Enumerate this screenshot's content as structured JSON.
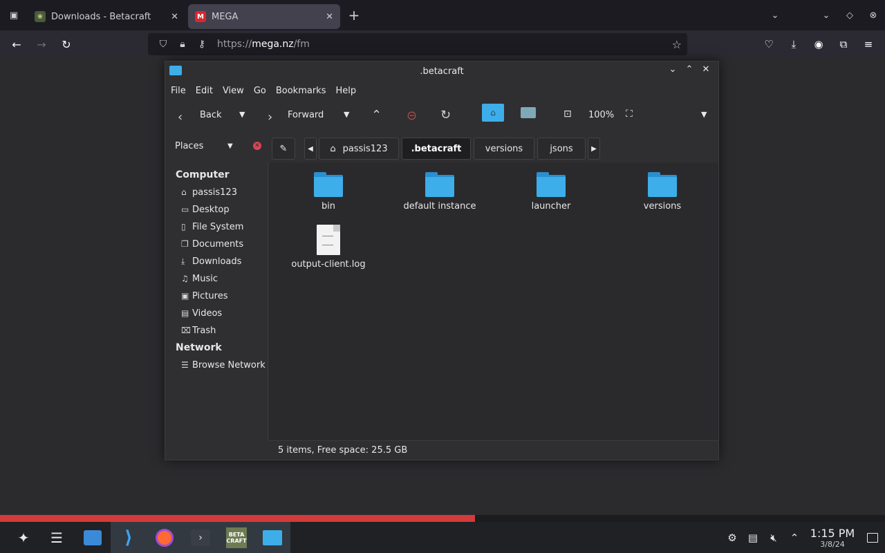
{
  "browser": {
    "tabs": [
      {
        "title": "Downloads - Betacraft",
        "close": "✕"
      },
      {
        "title": "MEGA",
        "icon_letter": "M",
        "close": "✕"
      }
    ],
    "new_tab": "+",
    "url_prefix": "https://",
    "url_host": "mega.nz",
    "url_path": "/fm"
  },
  "file_manager": {
    "title": ".betacraft",
    "menu": [
      "File",
      "Edit",
      "View",
      "Go",
      "Bookmarks",
      "Help"
    ],
    "toolbar": {
      "back_label": "Back",
      "forward_label": "Forward",
      "zoom_label": "100%"
    },
    "places_label": "Places",
    "breadcrumbs": [
      "passis123",
      ".betacraft",
      "versions",
      "jsons"
    ],
    "sidebar": {
      "computer_heading": "Computer",
      "computer_items": [
        {
          "label": "passis123",
          "icon": "home-icon"
        },
        {
          "label": "Desktop",
          "icon": "desktop-icon"
        },
        {
          "label": "File System",
          "icon": "drive-icon"
        },
        {
          "label": "Documents",
          "icon": "documents-icon"
        },
        {
          "label": "Downloads",
          "icon": "downloads-icon"
        },
        {
          "label": "Music",
          "icon": "music-icon"
        },
        {
          "label": "Pictures",
          "icon": "pictures-icon"
        },
        {
          "label": "Videos",
          "icon": "videos-icon"
        },
        {
          "label": "Trash",
          "icon": "trash-icon"
        }
      ],
      "network_heading": "Network",
      "network_items": [
        {
          "label": "Browse Network",
          "icon": "network-icon"
        }
      ]
    },
    "files": [
      {
        "name": "bin",
        "type": "folder"
      },
      {
        "name": "default instance",
        "type": "folder"
      },
      {
        "name": "launcher",
        "type": "folder"
      },
      {
        "name": "versions",
        "type": "folder"
      },
      {
        "name": "output-client.log",
        "type": "file"
      }
    ],
    "status": "5 items, Free space: 25.5 GB"
  },
  "progress_fraction": 0.537,
  "taskbar": {
    "betacraft_label": "BETA CRAFT",
    "time": "1:15 PM",
    "date": "3/8/24"
  },
  "colors": {
    "folder": "#3daee9",
    "progress": "#d33b3b",
    "taskbar": "#1f2124"
  }
}
